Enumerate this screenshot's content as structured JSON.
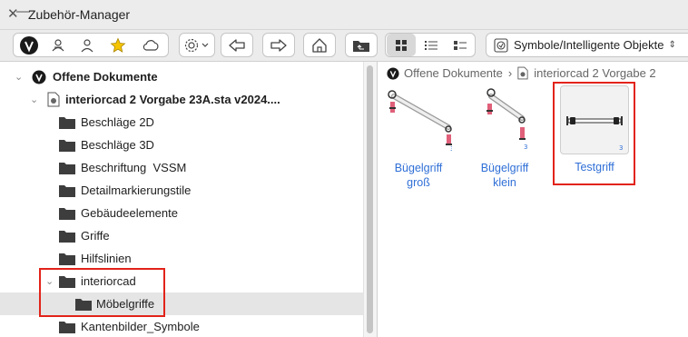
{
  "window": {
    "title": "Zubehör-Manager",
    "close_glyph": "✕",
    "minimize_glyph": "—"
  },
  "toolbar": {
    "view_path": "Symbole/Intelligente Objekte",
    "path_chevron": "⌃⌄"
  },
  "tree": {
    "root_label": "Offene Dokumente",
    "document_label": "interiorcad 2 Vorgabe 23A.sta v2024....",
    "folders": [
      "Beschläge 2D",
      "Beschläge 3D",
      "Beschriftung  VSSM",
      "Detailmarkierungstile",
      "Gebäudeelemente",
      "Griffe",
      "Hilfslinien",
      "interiorcad",
      "Möbelgriffe",
      "Kantenbilder_Symbole"
    ]
  },
  "breadcrumb": {
    "root": "Offene Dokumente",
    "separator": "›",
    "document": "interiorcad 2 Vorgabe 2"
  },
  "items": [
    {
      "line1": "Bügelgriff",
      "line2": "groß"
    },
    {
      "line1": "Bügelgriff",
      "line2": "klein"
    },
    {
      "line1": "Testgriff",
      "line2": ""
    }
  ],
  "colors": {
    "highlight_box": "#e2231a",
    "link_blue": "#2f6fd6",
    "selection_gray": "#e5e5e5"
  }
}
